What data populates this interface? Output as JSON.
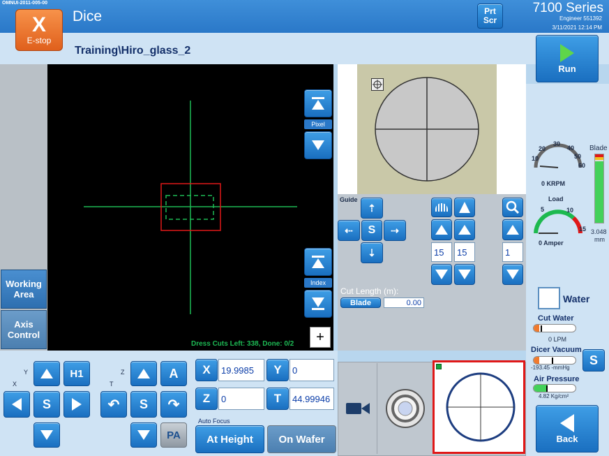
{
  "header": {
    "machine_id": "OMNUI-2011-005-00",
    "estop_label": "E-stop",
    "title": "Dice",
    "recipe": "Training\\Hiro_glass_2",
    "prtscr_line1": "Prt",
    "prtscr_line2": "Scr",
    "series": "7100 Series",
    "user": "Engineer 551392",
    "datetime": "3/11/2021 12:14 PM"
  },
  "run": {
    "label": "Run"
  },
  "camera": {
    "status": "Dress Cuts Left: 338, Done: 0/2",
    "pixel_label": "Pixel",
    "index_label": "Index",
    "plus_label": "+"
  },
  "side_tabs": [
    {
      "label": "Working Area"
    },
    {
      "label": "Axis Control"
    }
  ],
  "guide": {
    "label": "Guide",
    "s_label": "S",
    "field1": "15",
    "field2": "15",
    "field3": "1"
  },
  "cut_length": {
    "label": "Cut Length (m):",
    "blade_label": "Blade",
    "value": "0.00"
  },
  "axes": {
    "y_label": "Y",
    "x_label": "X",
    "z_label": "Z",
    "t_label": "T",
    "h1_label": "H1",
    "s_label": "S",
    "a_label": "A",
    "pa_label": "PA"
  },
  "positions": {
    "x": "19.9985",
    "y": "0",
    "z": "0",
    "t": "44.99946"
  },
  "auto_focus": {
    "label": "Auto Focus",
    "at_height": "At Height",
    "on_wafer": "On Wafer"
  },
  "spindle": {
    "ticks": [
      "10",
      "20",
      "30",
      "40",
      "50",
      "60"
    ],
    "speed": "0 KRPM",
    "load_label": "Load",
    "load_ticks": [
      "5",
      "10",
      "15"
    ],
    "load": "0 Amper",
    "blade_label": "Blade",
    "blade_value": "3.048",
    "blade_unit": "mm",
    "blade_level": 0.9
  },
  "water": {
    "label": "Water",
    "cut_water_label": "Cut Water",
    "cut_water_value": "0 LPM"
  },
  "vacuum": {
    "label": "Dicer Vacuum",
    "value": "-193.45 -mmHg",
    "s_label": "S"
  },
  "air": {
    "label": "Air Pressure",
    "value": "4.82 Kg/cm²"
  },
  "back": {
    "label": "Back"
  },
  "colors": {
    "accent": "#1a6fc0",
    "estop": "#f07a2e",
    "green": "#19a33d",
    "crosshair": "#1db954"
  }
}
